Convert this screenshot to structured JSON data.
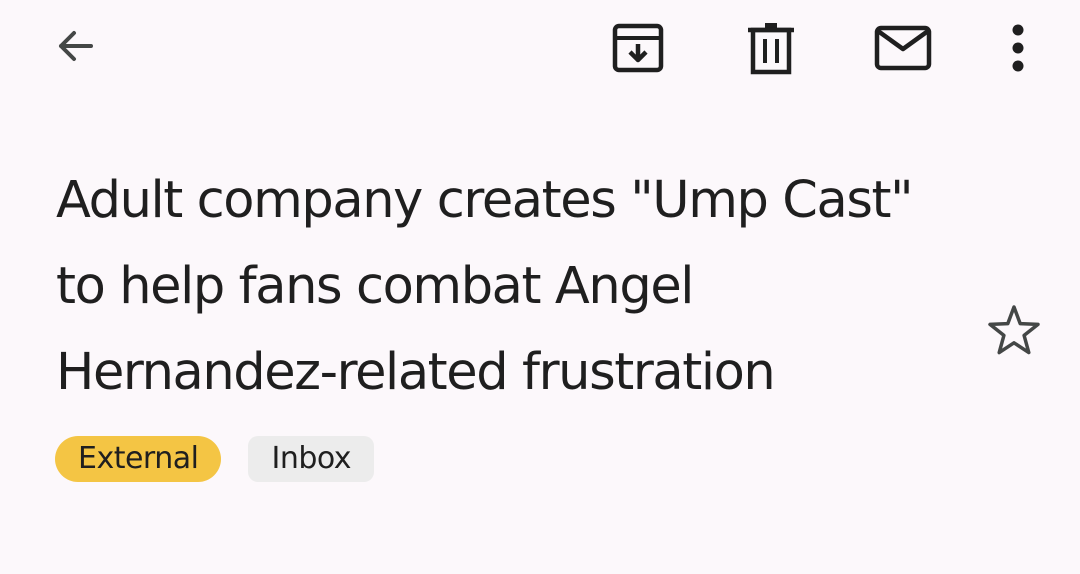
{
  "toolbar": {
    "back_icon": "arrow-back-icon",
    "archive_icon": "archive-icon",
    "delete_icon": "trash-icon",
    "mark_unread_icon": "mail-icon",
    "more_icon": "more-vert-icon"
  },
  "email": {
    "subject": "Adult company creates \"Ump Cast\" to help fans combat Angel Hernandez-related frustration",
    "starred": false,
    "star_icon": "star-outline-icon",
    "labels": [
      {
        "label": "External",
        "color": "#f4c544"
      },
      {
        "label": "Inbox",
        "color": "#ececec"
      }
    ]
  },
  "colors": {
    "background": "#fcf8fb",
    "text": "#1f1f1f",
    "icon": "#444746"
  }
}
